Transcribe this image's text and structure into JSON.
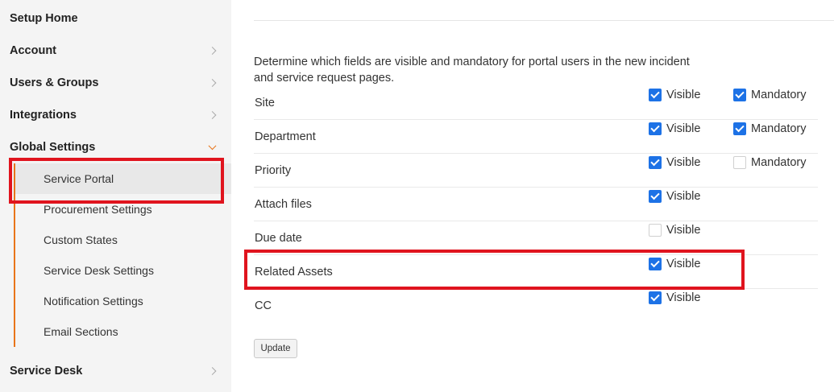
{
  "sidebar": {
    "top_items": [
      {
        "label": "Setup Home",
        "has_chevron": false
      },
      {
        "label": "Account",
        "has_chevron": true
      },
      {
        "label": "Users & Groups",
        "has_chevron": true
      },
      {
        "label": "Integrations",
        "has_chevron": true
      },
      {
        "label": "Global Settings",
        "has_chevron": true,
        "expanded": true
      }
    ],
    "sub_items": [
      {
        "label": "Service Portal",
        "active": true
      },
      {
        "label": "Procurement Settings"
      },
      {
        "label": "Custom States"
      },
      {
        "label": "Service Desk Settings"
      },
      {
        "label": "Notification Settings"
      },
      {
        "label": "Email Sections"
      }
    ],
    "bottom_item": {
      "label": "Service Desk",
      "has_chevron": true
    }
  },
  "main": {
    "description": "Determine which fields are visible and mandatory for portal users in the new incident and service request pages.",
    "visible_label": "Visible",
    "mandatory_label": "Mandatory",
    "fields": [
      {
        "name": "Site",
        "visible": true,
        "mandatory": true
      },
      {
        "name": "Department",
        "visible": true,
        "mandatory": true
      },
      {
        "name": "Priority",
        "visible": true,
        "mandatory": false
      },
      {
        "name": "Attach files",
        "visible": true
      },
      {
        "name": "Due date",
        "visible": false
      },
      {
        "name": "Related Assets",
        "visible": true
      },
      {
        "name": "CC",
        "visible": true
      }
    ],
    "update_label": "Update"
  },
  "colors": {
    "accent": "#e8741a",
    "checkbox": "#1d72e6",
    "highlight": "#e0141e"
  }
}
